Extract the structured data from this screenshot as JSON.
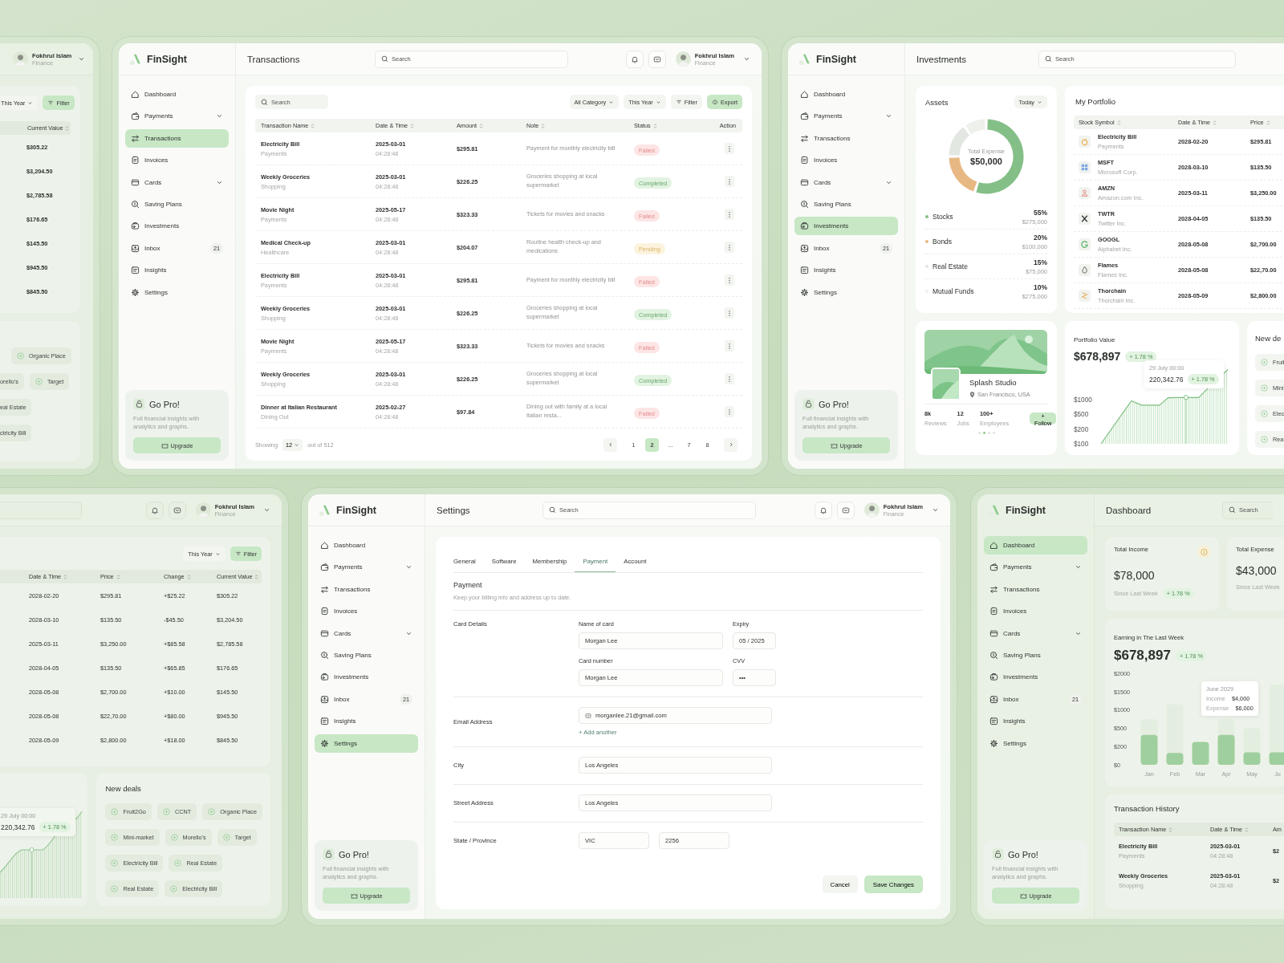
{
  "top_left_window": {
    "user": {
      "name": "Fokhrul Islam",
      "role": "Finance"
    },
    "year_button": "This Year",
    "filter_button": "Filter",
    "column": "Current Value",
    "values": [
      "$305.22",
      "$3,204.50",
      "$2,785.58",
      "$176.65",
      "$145.50",
      "$945.50",
      "$845.50"
    ],
    "chips": [
      {
        "label": "Organic Place"
      },
      {
        "label": "orello's"
      },
      {
        "label": "Target"
      },
      {
        "label": "eal Estate"
      },
      {
        "label": "ctricity Bill"
      }
    ]
  },
  "transactions_window": {
    "sidebar": {
      "brand": "FinSight",
      "items": [
        {
          "label": "Dashboard",
          "selected": false,
          "expandable": false
        },
        {
          "label": "Payments",
          "selected": false,
          "expandable": true
        },
        {
          "label": "Transactions",
          "selected": true,
          "expandable": false
        },
        {
          "label": "Invoices",
          "selected": false,
          "expandable": false
        },
        {
          "label": "Cards",
          "selected": false,
          "expandable": true
        },
        {
          "label": "Saving Plans",
          "selected": false,
          "expandable": false
        },
        {
          "label": "Investments",
          "selected": false,
          "expandable": false
        },
        {
          "label": "Inbox",
          "selected": false,
          "expandable": false,
          "badge": "21"
        },
        {
          "label": "Insights",
          "selected": false,
          "expandable": false
        },
        {
          "label": "Settings",
          "selected": false,
          "expandable": false
        }
      ],
      "promo": {
        "title": "Go Pro!",
        "text": "Full financial insights with analytics and graphs.",
        "button": "Upgrade"
      }
    },
    "title": "Transactions",
    "search": {
      "placeholder": "Search"
    },
    "user": {
      "name": "Fokhrul Islam",
      "role": "Finance"
    },
    "table_search": {
      "placeholder": "Search"
    },
    "dropdowns": [
      "All Category",
      "This Year"
    ],
    "filter_button": "Filter",
    "export_button": "Export",
    "columns": [
      "Transaction Name",
      "Date & Time",
      "Amount",
      "Note",
      "Status",
      "Action"
    ],
    "rows": [
      {
        "name": "Electricity Bill",
        "category": "Payments",
        "date": "2025-03-01",
        "time": "04:28:48",
        "amount": "$295.81",
        "note": "Payment for monthly electricity bill",
        "status": {
          "label": "Failed",
          "kind": "failed"
        }
      },
      {
        "name": "Weekly Groceries",
        "category": "Shopping",
        "date": "2025-03-01",
        "time": "04:28:48",
        "amount": "$226.25",
        "note": "Groceries shopping at local supermarket",
        "status": {
          "label": "Completed",
          "kind": "completed"
        }
      },
      {
        "name": "Movie Night",
        "category": "Payments",
        "date": "2025-05-17",
        "time": "04:28:48",
        "amount": "$323.33",
        "note": "Tickets for movies and snacks",
        "status": {
          "label": "Failed",
          "kind": "failed"
        }
      },
      {
        "name": "Medical Check-up",
        "category": "Healthcare",
        "date": "2025-03-01",
        "time": "04:28:48",
        "amount": "$204.07",
        "note": "Routine health check-up and medications",
        "status": {
          "label": "Pending",
          "kind": "pending"
        }
      },
      {
        "name": "Electricity Bill",
        "category": "Payments",
        "date": "2025-03-01",
        "time": "04:28:48",
        "amount": "$295.81",
        "note": "Payment for monthly electricity bill",
        "status": {
          "label": "Failed",
          "kind": "failed"
        }
      },
      {
        "name": "Weekly Groceries",
        "category": "Shopping",
        "date": "2025-03-01",
        "time": "04:28:48",
        "amount": "$226.25",
        "note": "Groceries shopping at local supermarket",
        "status": {
          "label": "Completed",
          "kind": "completed"
        }
      },
      {
        "name": "Movie Night",
        "category": "Payments",
        "date": "2025-05-17",
        "time": "04:28:48",
        "amount": "$323.33",
        "note": "Tickets for movies and snacks",
        "status": {
          "label": "Failed",
          "kind": "failed"
        }
      },
      {
        "name": "Weekly Groceries",
        "category": "Shopping",
        "date": "2025-03-01",
        "time": "04:28:48",
        "amount": "$226.25",
        "note": "Groceries shopping at local supermarket",
        "status": {
          "label": "Completed",
          "kind": "completed"
        }
      },
      {
        "name": "Dinner at Italian Restaurant",
        "category": "Dining Out",
        "date": "2025-02-27",
        "time": "04:28:48",
        "amount": "$97.84",
        "note": "Dining out with family at a local Italian resta...",
        "status": {
          "label": "Failed",
          "kind": "failed"
        }
      }
    ],
    "footer": {
      "showing": "Showing",
      "per_page": "12",
      "total": "out of 512"
    },
    "pages": [
      {
        "label": "1",
        "selected": false
      },
      {
        "label": "2",
        "selected": true
      },
      {
        "label": "...",
        "selected": false
      },
      {
        "label": "7",
        "selected": false
      },
      {
        "label": "8",
        "selected": false
      }
    ]
  },
  "investments_window": {
    "sidebar": {
      "brand": "FinSight",
      "items": [
        {
          "label": "Dashboard",
          "selected": false,
          "expandable": false
        },
        {
          "label": "Payments",
          "selected": false,
          "expandable": true
        },
        {
          "label": "Transactions",
          "selected": false,
          "expandable": false
        },
        {
          "label": "Invoices",
          "selected": false,
          "expandable": false
        },
        {
          "label": "Cards",
          "selected": false,
          "expandable": true
        },
        {
          "label": "Saving Plans",
          "selected": false,
          "expandable": false
        },
        {
          "label": "Investments",
          "selected": true,
          "expandable": false
        },
        {
          "label": "Inbox",
          "selected": false,
          "expandable": false,
          "badge": "21"
        },
        {
          "label": "Insights",
          "selected": false,
          "expandable": false
        },
        {
          "label": "Settings",
          "selected": false,
          "expandable": false
        }
      ],
      "promo": {
        "title": "Go Pro!",
        "text": "Full financial insights with analytics and graphs.",
        "button": "Upgrade"
      }
    },
    "title": "Investments",
    "search": {
      "placeholder": "Search"
    },
    "assets": {
      "title": "Assets",
      "period": "Today",
      "center_label": "Total Expense",
      "center_value": "$50,000",
      "chart_data": {
        "type": "donut",
        "categories": [
          "Stocks",
          "Bonds",
          "Real Estate",
          "Mutual Funds"
        ],
        "values": [
          55,
          20,
          15,
          10
        ]
      },
      "legend": [
        {
          "percent": "55%",
          "amount": "$275,000",
          "color": "#84bf87"
        },
        {
          "percent": "20%",
          "amount": "$100,000",
          "color": "#e8b884"
        },
        {
          "percent": "15%",
          "amount": "$75,000",
          "color": "#e3e7e1"
        },
        {
          "percent": "10%",
          "amount": "$275,000",
          "color": "#edf0eb"
        }
      ]
    },
    "portfolio": {
      "title": "My Portfolio",
      "columns": [
        "Stock Symbol",
        "Date & Time",
        "Price"
      ],
      "rows": [
        {
          "symbol": "Electricity Bill",
          "company": "Payments",
          "date": "2028-02-20",
          "price": "$295.81"
        },
        {
          "symbol": "MSFT",
          "company": "Microsoft Corp.",
          "date": "2028-03-10",
          "price": "$135.50"
        },
        {
          "symbol": "AMZN",
          "company": "Amazon.com Inc.",
          "date": "2025-03-11",
          "price": "$3,250.00"
        },
        {
          "symbol": "TWTR",
          "company": "Twitter Inc.",
          "date": "2028-04-05",
          "price": "$135.50"
        },
        {
          "symbol": "GOOGL",
          "company": "Alphabet Inc.",
          "date": "2028-05-08",
          "price": "$2,700.00"
        },
        {
          "symbol": "Flames",
          "company": "Flames Inc.",
          "date": "2028-05-08",
          "price": "$22,70.00"
        },
        {
          "symbol": "Thorchain",
          "company": "Thorchain Inc.",
          "date": "2028-05-09",
          "price": "$2,800.00"
        }
      ]
    },
    "studio": {
      "name": "Splash Studio",
      "location": "San Francisco, USA",
      "stats": [
        {
          "value": "8k",
          "label": "Reviews"
        },
        {
          "value": "12",
          "label": "Jobs"
        },
        {
          "value": "100+",
          "label": "Employees"
        }
      ],
      "follow_button": "+ Follow",
      "slides": [
        {
          "selected": false
        },
        {
          "selected": true
        },
        {
          "selected": false
        },
        {
          "selected": false
        }
      ]
    },
    "portfolio_value": {
      "title": "Portfolio Value",
      "amount": "$678,897",
      "change": "+ 1.78 %",
      "y_axis_labels": [
        "$1000",
        "$500",
        "$200",
        "$100"
      ],
      "tooltip": {
        "date": "29 July 00:00",
        "value": "220,342.76",
        "change": "+ 1.78 %"
      }
    },
    "deals": {
      "title": "New de",
      "chips": [
        "Fruit",
        "Mini",
        "Elec",
        "Real"
      ]
    }
  },
  "bottom_left_window": {
    "user": {
      "name": "Fokhrul Islam",
      "role": "Finance"
    },
    "year_button": "This Year",
    "filter_button": "Filter",
    "columns": [
      "Date & Time",
      "Price",
      "Change",
      "Current Value"
    ],
    "rows": [
      [
        "2028-02-20",
        "$295.81",
        "+$25.22",
        "$305.22"
      ],
      [
        "2028-03-10",
        "$135.50",
        "-$45.50",
        "$3,204.50"
      ],
      [
        "2025-03-11",
        "$3,250.00",
        "+$85.58",
        "$2,785.58"
      ],
      [
        "2028-04-05",
        "$135.50",
        "+$65.85",
        "$176.65"
      ],
      [
        "2028-05-08",
        "$2,700.00",
        "+$10.00",
        "$145.50"
      ],
      [
        "2028-05-08",
        "$22,70.00",
        "+$80.00",
        "$945.50"
      ],
      [
        "2028-05-09",
        "$2,800.00",
        "+$18.00",
        "$845.50"
      ]
    ],
    "tooltip": {
      "date": "29 July 00:00",
      "value": "220,342.76",
      "change": "+ 1.78 %"
    },
    "deals": {
      "title": "New deals",
      "chips": [
        [
          "Fruit2Go",
          "CCNT",
          "Organic Place"
        ],
        [
          "Mini-market",
          "Morello's",
          "Target"
        ],
        [
          "Electricity Bill",
          "Real Estate"
        ],
        [
          "Real Estate",
          "Electricity Bill"
        ]
      ]
    }
  },
  "settings_window": {
    "sidebar": {
      "brand": "FinSight",
      "items": [
        {
          "label": "Dashboard",
          "selected": false,
          "expandable": false
        },
        {
          "label": "Payments",
          "selected": false,
          "expandable": true
        },
        {
          "label": "Transactions",
          "selected": false,
          "expandable": false
        },
        {
          "label": "Invoices",
          "selected": false,
          "expandable": false
        },
        {
          "label": "Cards",
          "selected": false,
          "expandable": true
        },
        {
          "label": "Saving Plans",
          "selected": false,
          "expandable": false
        },
        {
          "label": "Investments",
          "selected": false,
          "expandable": false
        },
        {
          "label": "Inbox",
          "selected": false,
          "expandable": false,
          "badge": "21"
        },
        {
          "label": "Insights",
          "selected": false,
          "expandable": false
        },
        {
          "label": "Settings",
          "selected": true,
          "expandable": false
        }
      ],
      "promo": {
        "title": "Go Pro!",
        "text": "Full financial insights with analytics and graphs.",
        "button": "Upgrade"
      }
    },
    "title": "Settings",
    "search": {
      "placeholder": "Search"
    },
    "user": {
      "name": "Fokhrul Islam",
      "role": "Finance"
    },
    "tabs": [
      {
        "label": "General",
        "selected": false
      },
      {
        "label": "Software",
        "selected": false
      },
      {
        "label": "Membership",
        "selected": false
      },
      {
        "label": "Payment",
        "selected": true
      },
      {
        "label": "Account",
        "selected": false
      }
    ],
    "section": {
      "title": "Payment",
      "subtitle": "Keep your billing info and address up to date."
    },
    "card_details": {
      "label": "Card Details",
      "fields": [
        {
          "label": "Name of card",
          "value": "Morgan Lee"
        },
        {
          "label": "Expiry",
          "value": "05 / 2025"
        },
        {
          "label": "Card number",
          "value": "Morgan Lee"
        },
        {
          "label": "CVV",
          "value": "•••"
        }
      ]
    },
    "email": {
      "label": "Email Address",
      "value": "morganlee.21@gmail.com",
      "add_link": "+ Add another"
    },
    "city": {
      "label": "City",
      "value": "Los Angeles"
    },
    "street": {
      "label": "Street Address",
      "value": "Los Angeles"
    },
    "state": {
      "label": "State / Province",
      "values": [
        "VIC",
        "2256"
      ]
    },
    "cancel_button": "Cancel",
    "save_button": "Save Changes"
  },
  "dashboard_window": {
    "sidebar": {
      "brand": "FinSight",
      "items": [
        {
          "label": "Dashboard",
          "selected": true,
          "expandable": false
        },
        {
          "label": "Payments",
          "selected": false,
          "expandable": true
        },
        {
          "label": "Transactions",
          "selected": false,
          "expandable": false
        },
        {
          "label": "Invoices",
          "selected": false,
          "expandable": false
        },
        {
          "label": "Cards",
          "selected": false,
          "expandable": true
        },
        {
          "label": "Saving Plans",
          "selected": false,
          "expandable": false
        },
        {
          "label": "Investments",
          "selected": false,
          "expandable": false
        },
        {
          "label": "Inbox",
          "selected": false,
          "expandable": false,
          "badge": "21"
        },
        {
          "label": "Insights",
          "selected": false,
          "expandable": false
        },
        {
          "label": "Settings",
          "selected": false,
          "expandable": false
        }
      ],
      "promo": {
        "title": "Go Pro!",
        "text": "Full financial insights with analytics and graphs.",
        "button": "Upgrade"
      }
    },
    "title": "Dashboard",
    "search": {
      "placeholder": "Search"
    },
    "income": {
      "title": "Total Income",
      "amount": "$78,000",
      "note": "Since Last Week",
      "change": "+ 1.78 %"
    },
    "expense": {
      "title": "Total Expense",
      "amount": "$43,000",
      "note": "Since Last Week"
    },
    "earning": {
      "title": "Earning in The Last Week",
      "amount": "$678,897",
      "change": "+ 1.78 %",
      "y_axis_labels": [
        "$2000",
        "$1500",
        "$1000",
        "$500",
        "$200",
        "$0"
      ],
      "x_axis_labels": [
        "Jan",
        "Feb",
        "Mar",
        "Apr",
        "May",
        "Ju"
      ],
      "tooltip": {
        "title": "June 2029",
        "rows": [
          {
            "label": "Income",
            "value": "$4,000"
          },
          {
            "label": "Expense",
            "value": "$6,000"
          }
        ]
      }
    },
    "history": {
      "title": "Transaction History",
      "columns": [
        "Transaction Name",
        "Date & Time",
        "Am"
      ],
      "rows": [
        {
          "name": "Electricity Bill",
          "category": "Payments",
          "date": "2025-03-01",
          "time": "04:28:48",
          "amount": "$2"
        },
        {
          "name": "Weekly Groceries",
          "category": "Shopping",
          "date": "2025-03-01",
          "time": "04:28:48",
          "amount": "$2"
        }
      ]
    }
  }
}
